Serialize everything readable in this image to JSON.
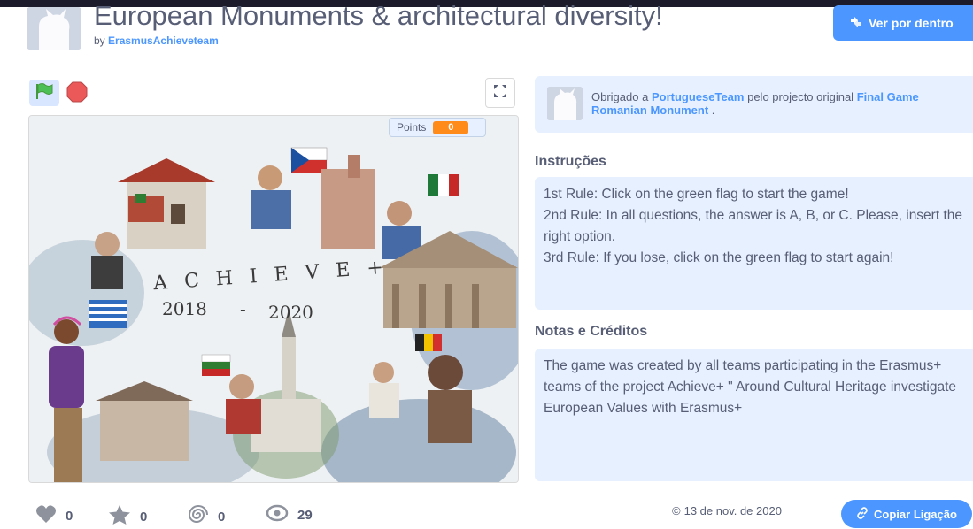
{
  "header": {
    "title": "European Monuments & architectural diversity!",
    "by_prefix": "by",
    "author": "ErasmusAchieveteam",
    "see_inside_label": "Ver por dentro",
    "see_inside_icon": "remix-arrows-icon"
  },
  "controls": {
    "flag_icon": "green-flag-icon",
    "stop_icon": "stop-icon",
    "fullscreen_icon": "fullscreen-icon"
  },
  "stage": {
    "monitor_label": "Points",
    "monitor_value": "0",
    "art_letters": "A C H I E V E +",
    "art_years_start": "2018",
    "art_dash": "-",
    "art_years_end": "2020"
  },
  "remix_credit": {
    "prefix": "Obrigado a",
    "team": "PortugueseTeam",
    "middle": "pelo projecto original",
    "project": "Final Game Romanian Monument",
    "suffix": "."
  },
  "instructions": {
    "heading": "Instruções",
    "lines": [
      "1st Rule: Click on the green flag to start the game!",
      "2nd Rule: In all questions, the answer is A, B, or C. Please, insert the right option.",
      "3rd Rule: If you lose, click on the green flag to start again!"
    ]
  },
  "notes": {
    "heading": "Notas e Créditos",
    "text": "The game was created by all teams participating in the Erasmus+ teams of the project Achieve+ \" Around Cultural Heritage investigate European Values with Erasmus+"
  },
  "stats": {
    "loves": "0",
    "favorites": "0",
    "remixes": "0",
    "views": "29"
  },
  "date": "13 de nov. de 2020",
  "copy_link_label": "Copiar Ligação",
  "colors": {
    "accent": "#4c97ff",
    "flag_green": "#4cbf56",
    "stop_red": "#ec5959",
    "monitor_orange": "#ff8c1a"
  }
}
